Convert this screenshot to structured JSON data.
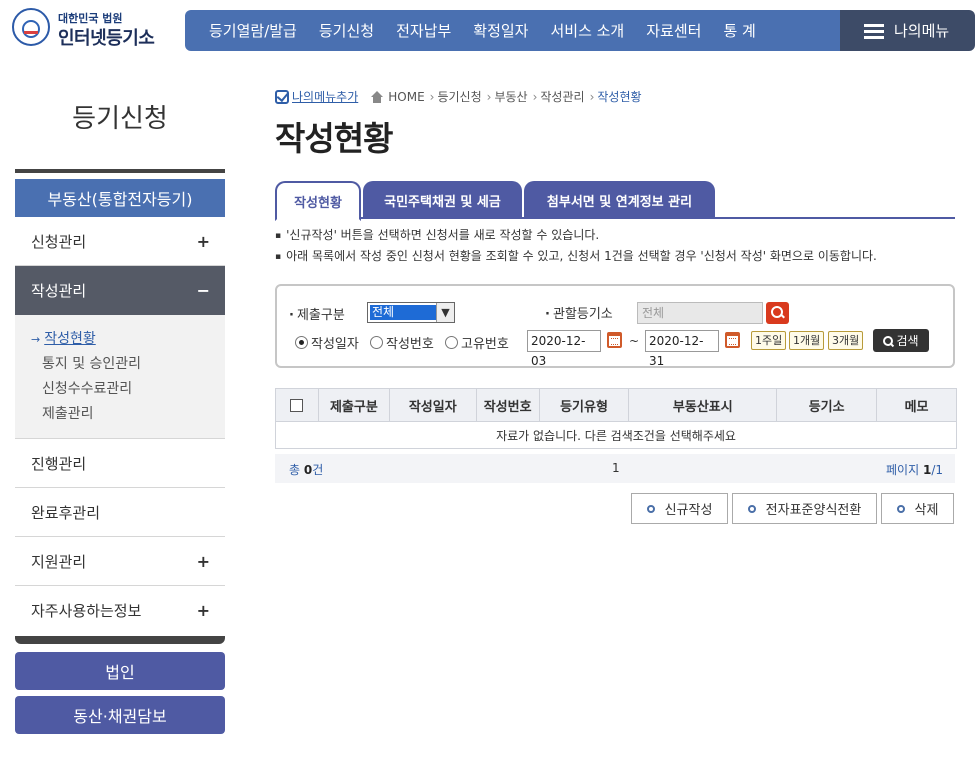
{
  "logo": {
    "small": "대한민국 법원",
    "big": "인터넷등기소"
  },
  "gnb": [
    "등기열람/발급",
    "등기신청",
    "전자납부",
    "확정일자",
    "서비스 소개",
    "자료센터",
    "통 계"
  ],
  "mymenu": "나의메뉴",
  "sidebar": {
    "title": "등기신청",
    "category": "부동산(통합전자등기)",
    "items": [
      {
        "label": "신청관리",
        "sign": "+"
      },
      {
        "label": "작성관리",
        "sign": "−"
      },
      {
        "label": "진행관리",
        "sign": ""
      },
      {
        "label": "완료후관리",
        "sign": ""
      },
      {
        "label": "지원관리",
        "sign": "+"
      },
      {
        "label": "자주사용하는정보",
        "sign": "+"
      }
    ],
    "sub": {
      "arrow": "→",
      "items": [
        "작성현황",
        "통지 및 승인관리",
        "신청수수료관리",
        "제출관리"
      ]
    },
    "buttons": [
      "법인",
      "동산·채권담보"
    ]
  },
  "breadcrumb": {
    "add": "나의메뉴추가",
    "items": [
      "HOME",
      "등기신청",
      "부동산",
      "작성관리",
      "작성현황"
    ]
  },
  "page_title": "작성현황",
  "tabs": [
    "작성현황",
    "국민주택채권 및 세금",
    "첨부서면 및 연계정보 관리"
  ],
  "notes": [
    "'신규작성' 버튼을 선택하면 신청서를 새로 작성할 수 있습니다.",
    "아래 목록에서 작성 중인 신청서 현황을 조회할 수 있고, 신청서 1건을 선택할 경우 '신청서 작성' 화면으로 이동합니다."
  ],
  "search": {
    "submit_type_label": "제출구분",
    "submit_type_value": "전체",
    "court_label": "관할등기소",
    "court_placeholder": "전체",
    "radios": [
      {
        "label": "작성일자",
        "checked": true
      },
      {
        "label": "작성번호",
        "checked": false
      },
      {
        "label": "고유번호",
        "checked": false
      }
    ],
    "date_from": "2020-12-03",
    "tilde": "~",
    "date_to": "2020-12-31",
    "periods": [
      "1주일",
      "1개월",
      "3개월"
    ],
    "search_button": "검색"
  },
  "table": {
    "headers": [
      "제출구분",
      "작성일자",
      "작성번호",
      "등기유형",
      "부동산표시",
      "등기소",
      "메모"
    ],
    "empty": "자료가 없습니다. 다른 검색조건을 선택해주세요"
  },
  "pager": {
    "total_prefix": "총",
    "total_count": "0",
    "total_suffix": "건",
    "page_number": "1",
    "page_label": "페이지",
    "page_current": "1",
    "page_sep": "/",
    "page_total": "1"
  },
  "actions": [
    "신규작성",
    "전자표준양식전환",
    "삭제"
  ],
  "colors": {
    "primary": "#4a70b1",
    "sidebar_button": "#4f5aa3",
    "dark": "#3d4b67",
    "accent_red": "#d93a1e"
  }
}
